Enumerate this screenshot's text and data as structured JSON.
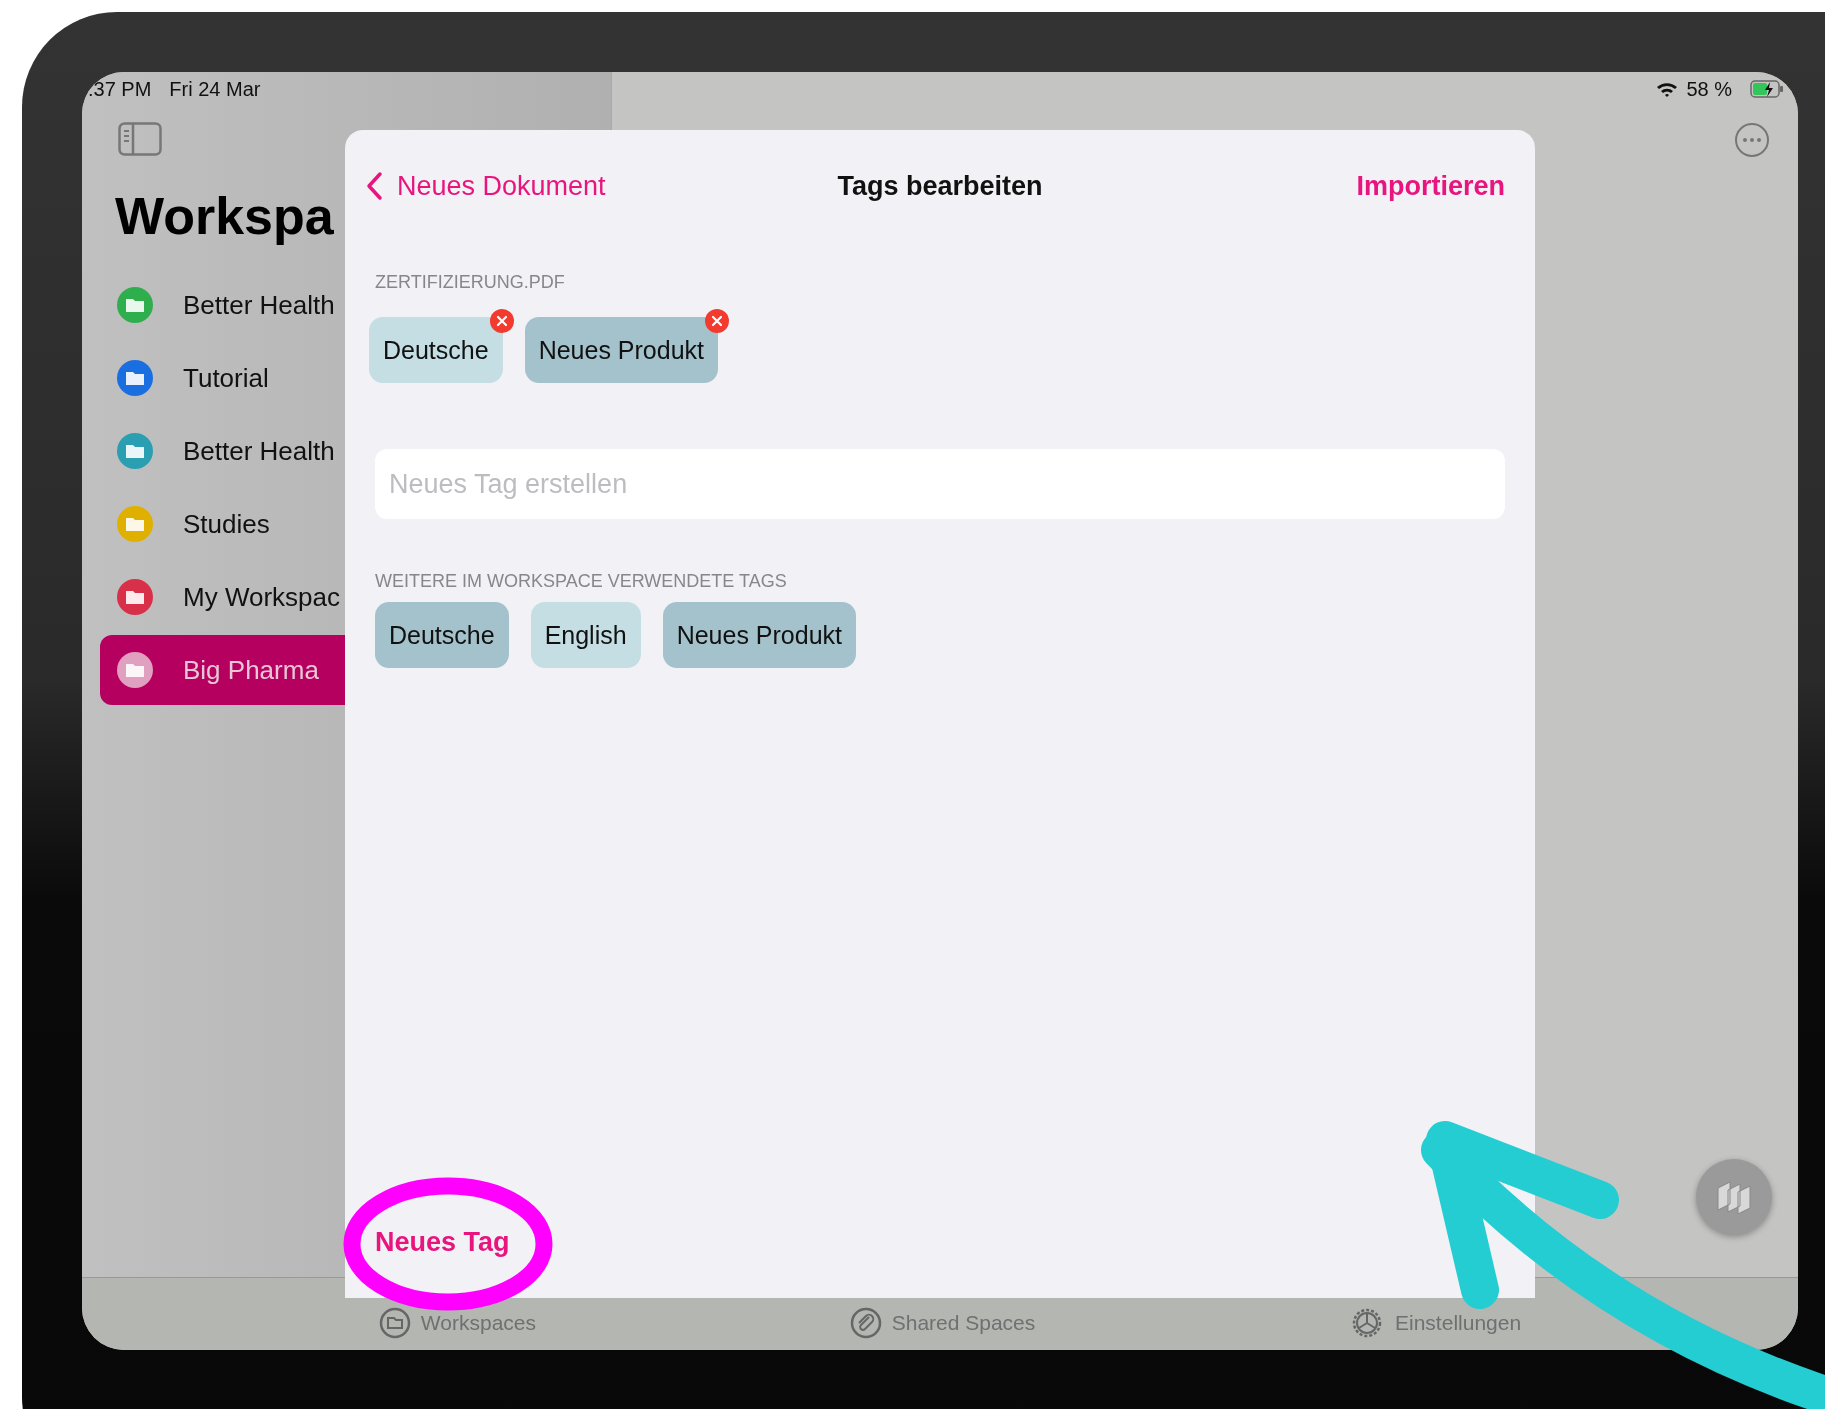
{
  "status_bar": {
    "time": ":37 PM",
    "date": "Fri 24 Mar",
    "battery": "58 %"
  },
  "sidebar": {
    "title": "Workspa",
    "items": [
      {
        "label": "Better Health",
        "color": "#2fae4e",
        "selected": false
      },
      {
        "label": "Tutorial",
        "color": "#1a6fe0",
        "selected": false
      },
      {
        "label": "Better Health",
        "color": "#2a9fb2",
        "selected": false
      },
      {
        "label": "Studies",
        "color": "#e0b000",
        "selected": false
      },
      {
        "label": "My Workspac",
        "color": "#d9304a",
        "selected": false
      },
      {
        "label": "Big Pharma",
        "color": "#e0a0c0",
        "selected": true
      }
    ]
  },
  "modal": {
    "back": "Neues Dokument",
    "title": "Tags bearbeiten",
    "action": "Importieren",
    "file_label": "ZERTIFIZIERUNG.PDF",
    "file_tags": [
      {
        "label": "Deutsche",
        "color": "#c4dee3",
        "removable": true
      },
      {
        "label": "Neues Produkt",
        "color": "#a3c2cb",
        "removable": true
      }
    ],
    "new_tag_field": {
      "placeholder": "Neues Tag erstellen"
    },
    "other_label": "WEITERE IM WORKSPACE VERWENDETE TAGS",
    "other_tags": [
      {
        "label": "Deutsche",
        "color": "#a3c2cb",
        "removable": false
      },
      {
        "label": "English",
        "color": "#c4dee3",
        "removable": false
      },
      {
        "label": "Neues Produkt",
        "color": "#a3c2cb",
        "removable": false
      }
    ],
    "bottom_button": "Neues Tag"
  },
  "tab_bar": [
    {
      "label": "Workspaces",
      "kind": "folder"
    },
    {
      "label": "Shared Spaces",
      "kind": "clip"
    },
    {
      "label": "Einstellungen",
      "kind": "gear"
    }
  ]
}
